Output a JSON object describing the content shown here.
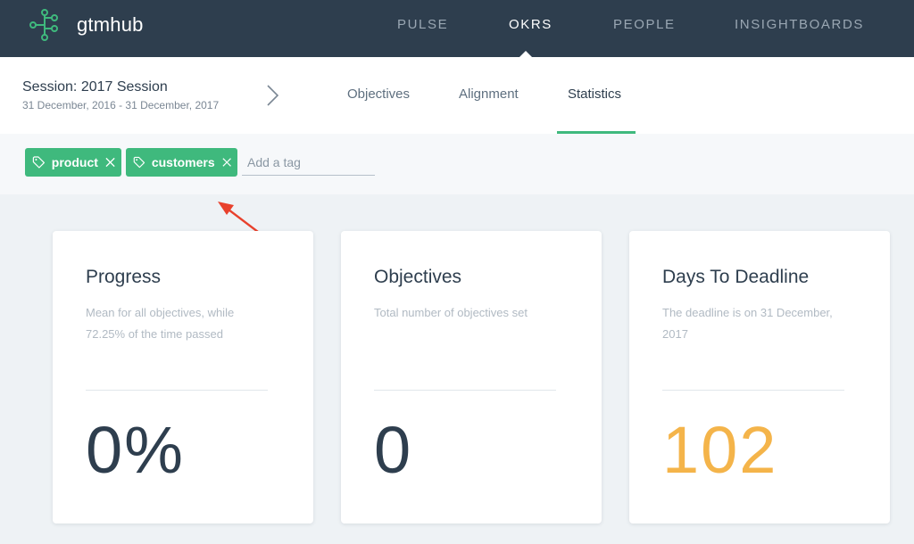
{
  "app": {
    "brand": "gtmhub"
  },
  "nav": {
    "items": [
      {
        "label": "PULSE",
        "active": false
      },
      {
        "label": "OKRS",
        "active": true
      },
      {
        "label": "PEOPLE",
        "active": false
      },
      {
        "label": "INSIGHTBOARDS",
        "active": false
      }
    ]
  },
  "session": {
    "title": "Session: 2017 Session",
    "dates": "31 December, 2016 - 31 December, 2017"
  },
  "tabs": [
    {
      "label": "Objectives",
      "active": false
    },
    {
      "label": "Alignment",
      "active": false
    },
    {
      "label": "Statistics",
      "active": true
    }
  ],
  "tags": {
    "items": [
      {
        "label": "product"
      },
      {
        "label": "customers"
      }
    ],
    "input_placeholder": "Add a tag",
    "input_value": ""
  },
  "cards": [
    {
      "title": "Progress",
      "description": "Mean for all objectives, while 72.25% of the time passed",
      "value": "0%"
    },
    {
      "title": "Objectives",
      "description": "Total number of objectives set",
      "value": "0"
    },
    {
      "title": "Days To Deadline",
      "description": "The deadline is on 31 December, 2017",
      "value": "102"
    }
  ],
  "colors": {
    "topbar": "#2e3e4e",
    "accent_green": "#3fb97d",
    "deadline_orange": "#f4b44a",
    "annotation_arrow": "#e8412c"
  },
  "icons": {
    "logo": "tree-network-icon",
    "tag": "tag-icon",
    "remove": "close-icon",
    "chevron": "chevron-right-icon",
    "annotation": "arrow-icon"
  }
}
